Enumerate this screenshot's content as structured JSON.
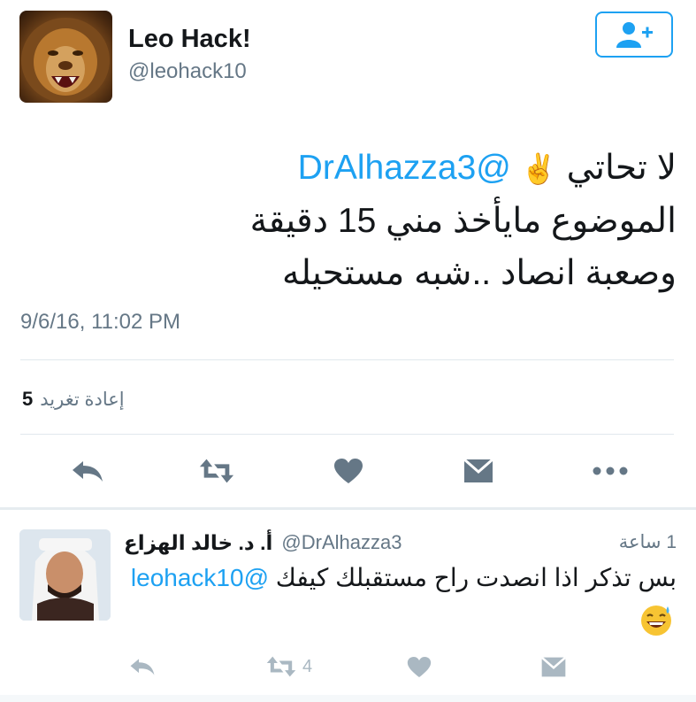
{
  "profile": {
    "display_name": "Leo Hack!",
    "handle": "@leohack10"
  },
  "follow_button": {
    "icon": "add-user-icon"
  },
  "tweet": {
    "mention": "@DrAlhazza3",
    "emoji": "✌️",
    "line1_text": "لا تحاتي",
    "line2": "الموضوع مايأخذ مني 15 دقيقة",
    "line3": "وصعبة انصاد ..شبه مستحيله",
    "timestamp": "9/6/16, 11:02 PM",
    "retweet_count": "5",
    "retweet_label": "إعادة تغريد"
  },
  "actions": [
    "reply-icon",
    "retweet-icon",
    "like-icon",
    "message-icon",
    "more-icon"
  ],
  "reply": {
    "name": "أ. د. خالد الهزاع",
    "handle": "@DrAlhazza3",
    "time": "1 ساعة",
    "mention": "@leohack10",
    "text": "بس تذكر اذا انصدت راح مستقبلك كيفك",
    "emoji": "😅",
    "retweet_count": "4"
  },
  "colors": {
    "accent": "#1da1f2",
    "text": "#14171a",
    "muted": "#657786",
    "icon": "#657786",
    "icon_light": "#aab8c2"
  }
}
